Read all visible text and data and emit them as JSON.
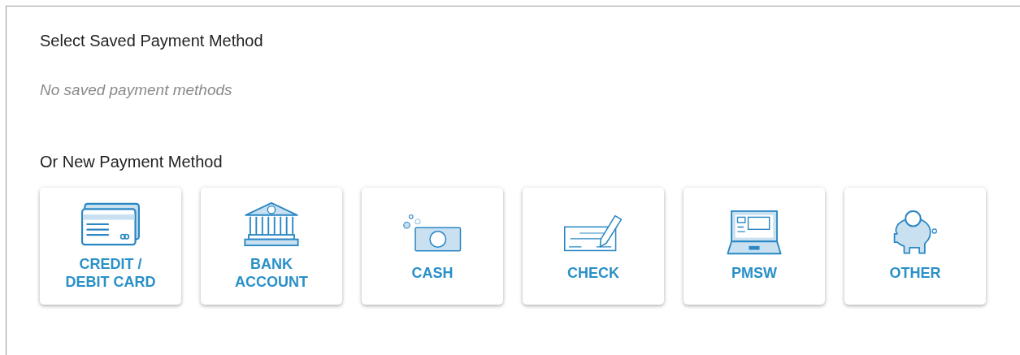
{
  "saved_section": {
    "heading": "Select Saved Payment Method",
    "empty_message": "No saved payment methods"
  },
  "new_section": {
    "heading": "Or New Payment Method",
    "methods": [
      {
        "kind": "card",
        "label": "CREDIT /\nDEBIT CARD"
      },
      {
        "kind": "bank",
        "label": "BANK\nACCOUNT"
      },
      {
        "kind": "cash",
        "label": "CASH"
      },
      {
        "kind": "check",
        "label": "CHECK"
      },
      {
        "kind": "laptop",
        "label": "PMSW"
      },
      {
        "kind": "piggy",
        "label": "OTHER"
      }
    ]
  }
}
